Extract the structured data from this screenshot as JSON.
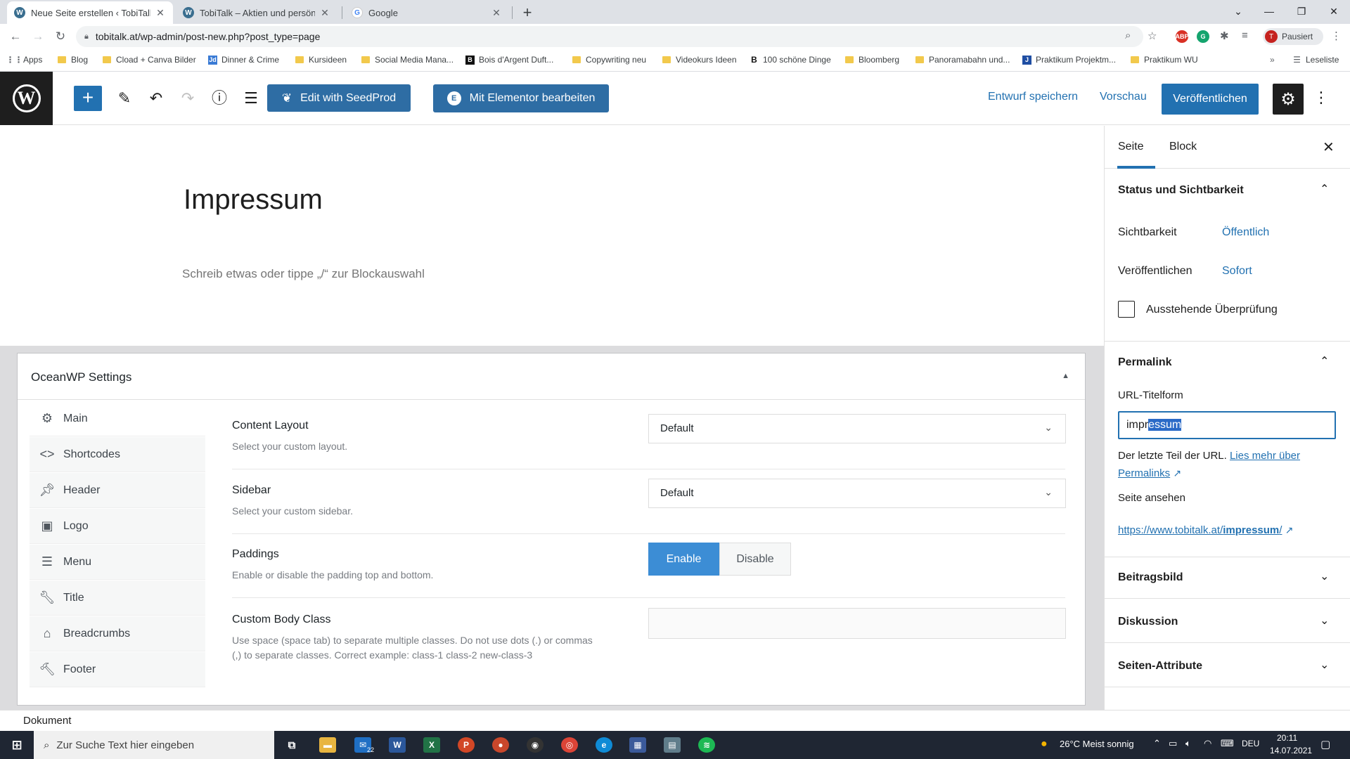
{
  "browser": {
    "tabs": [
      {
        "title": "Neue Seite erstellen ‹ TobiTalk —",
        "favicon": "W",
        "active": true
      },
      {
        "title": "TobiTalk – Aktien und persönlich",
        "favicon": "W",
        "active": false
      },
      {
        "title": "Google",
        "favicon": "G",
        "active": false
      }
    ],
    "url": "tobitalk.at/wp-admin/post-new.php?post_type=page",
    "profile_label": "Pausiert",
    "profile_initial": "T",
    "bookmarks": [
      "Apps",
      "Blog",
      "Cload + Canva Bilder",
      "Dinner & Crime",
      "Kursideen",
      "Social Media Mana...",
      "Bois d'Argent Duft...",
      "Copywriting neu",
      "Videokurs Ideen",
      "100 schöne Dinge",
      "Bloomberg",
      "Panoramabahn und...",
      "Praktikum Projektm...",
      "Praktikum WU"
    ],
    "reading_list": "Leseliste"
  },
  "wp_toolbar": {
    "seedprod_label": "Edit with SeedProd",
    "elementor_label": "Mit Elementor bearbeiten",
    "save_draft": "Entwurf speichern",
    "preview": "Vorschau",
    "publish": "Veröffentlichen"
  },
  "editor": {
    "title": "Impressum",
    "placeholder": "Schreib etwas oder tippe „/“ zur Blockauswahl"
  },
  "oceanwp": {
    "heading": "OceanWP Settings",
    "nav": [
      {
        "label": "Main",
        "icon": "gear-icon"
      },
      {
        "label": "Shortcodes",
        "icon": "code-icon"
      },
      {
        "label": "Header",
        "icon": "pin-icon"
      },
      {
        "label": "Logo",
        "icon": "image-icon"
      },
      {
        "label": "Menu",
        "icon": "menu-icon"
      },
      {
        "label": "Title",
        "icon": "wrench-icon"
      },
      {
        "label": "Breadcrumbs",
        "icon": "home-icon"
      },
      {
        "label": "Footer",
        "icon": "hammer-icon"
      }
    ],
    "content_layout": {
      "label": "Content Layout",
      "desc": "Select your custom layout.",
      "value": "Default"
    },
    "sidebar": {
      "label": "Sidebar",
      "desc": "Select your custom sidebar.",
      "value": "Default"
    },
    "paddings": {
      "label": "Paddings",
      "desc": "Enable or disable the padding top and bottom.",
      "enable": "Enable",
      "disable": "Disable"
    },
    "body_class": {
      "label": "Custom Body Class",
      "desc": "Use space (space tab) to separate multiple classes. Do not use dots (.) or commas (,) to separate classes. Correct example: class-1 class-2 new-class-3",
      "value": ""
    }
  },
  "sidebar": {
    "tab_page": "Seite",
    "tab_block": "Block",
    "status_title": "Status und Sichtbarkeit",
    "visibility_label": "Sichtbarkeit",
    "visibility_value": "Öffentlich",
    "publish_label": "Veröffentlichen",
    "publish_value": "Sofort",
    "pending_review": "Ausstehende Überprüfung",
    "permalink_title": "Permalink",
    "url_slug_label": "URL-Titelform",
    "slug_unselected": "impr",
    "slug_selected": "essum",
    "slug_help": "Der letzte Teil der URL.",
    "slug_help_link": "Lies mehr über Permalinks",
    "view_page_label": "Seite ansehen",
    "view_page_url_base": "https://www.tobitalk.at/",
    "view_page_url_bold": "impressum",
    "view_page_url_end": "/",
    "featured_image": "Beitragsbild",
    "discussion": "Diskussion",
    "page_attributes": "Seiten-Attribute"
  },
  "footer_breadcrumb": "Dokument",
  "taskbar": {
    "search_placeholder": "Zur Suche Text hier eingeben",
    "weather": "26°C  Meist sonnig",
    "lang": "DEU",
    "time": "20:11",
    "date": "14.07.2021",
    "mail_badge": "22"
  }
}
